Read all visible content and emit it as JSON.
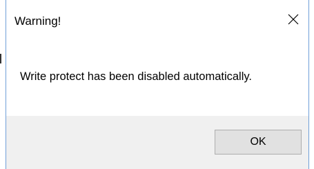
{
  "dialog": {
    "title": "Warning!",
    "message": "Write protect has been disabled automatically.",
    "close_icon": "close-icon",
    "ok_label": "OK"
  },
  "colors": {
    "frame_border": "#6f9fd8",
    "footer_bg": "#f0f0f0",
    "button_bg": "#e1e1e1",
    "button_border": "#adadad"
  }
}
